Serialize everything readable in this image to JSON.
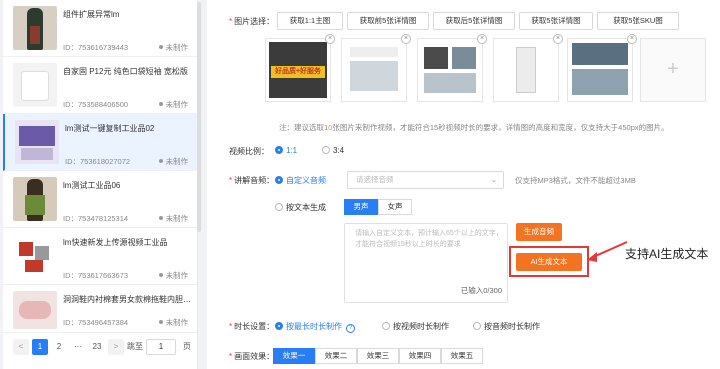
{
  "products": [
    {
      "title": "组件扩展异常lm",
      "id": "ID：753616739443",
      "status": "未制作"
    },
    {
      "title": "自家固 P12元 纯色口袋短袖 宽松版",
      "id": "ID：753588406500",
      "status": "未制作"
    },
    {
      "title": "lm测试一键复制工业品02",
      "id": "ID：753618027072",
      "status": "未制作"
    },
    {
      "title": "lm测试工业品06",
      "id": "ID：753478125314",
      "status": "未制作"
    },
    {
      "title": "lm快速新发上传源视频工业品",
      "id": "ID：753617663673",
      "status": "未制作"
    },
    {
      "title": "洞洞鞋内衬棉套男女款棉拖鞋内胆可…",
      "id": "ID：753496457384",
      "status": "未制作"
    }
  ],
  "pager": {
    "prev": "<",
    "page1": "1",
    "page2": "2",
    "ellipsis": "···",
    "last": "23",
    "next": ">",
    "goto_label": "跳至",
    "goto_value": "1",
    "page_suffix": "页"
  },
  "form": {
    "image_label": "图片选择：",
    "image_buttons": [
      "获取1:1主图",
      "获取前5张详情图",
      "获取后5张详情图",
      "获取5张详情图",
      "获取5张SKU图"
    ],
    "banner_text": "好品质+好服务",
    "add_icon": "plus-icon",
    "note_prefix": "注：建议选取1",
    "note_highlight": "0",
    "note_suffix": "张图片来制作视频，才能符合15秒视频时长的要求，详情图的高度和宽度，仅支持大于450px的图片。",
    "ratio_label": "视频比例：",
    "ratio_1": "1:1",
    "ratio_2": "3:4",
    "audio_label": "讲解音频：",
    "custom_audio": "自定义音频",
    "audio_placeholder": "请选择音频",
    "audio_hint": "仅支持MP3格式，文件不能超过3MB",
    "text_gen": "按文本生成",
    "male_voice": "男声",
    "female_voice": "女声",
    "textarea_placeholder": "请输入自定义文本，预计输入65个以上的文字，才能符合视频15秒以上时长的要求",
    "char_count": "已输入0/300",
    "gen_audio_button": "生成音频",
    "ai_text_button": "AI生成文本",
    "callout": "支持AI生成文本",
    "duration_label": "时长设置：",
    "dur_1": "按最长时长制作",
    "dur_2": "按视频时长制作",
    "dur_3": "按音频时长制作",
    "effect_label": "画面效果：",
    "effects": [
      "效果一",
      "效果二",
      "效果三",
      "效果四",
      "效果五"
    ]
  },
  "colors": {
    "accent": "#2a7ef4",
    "orange": "#f37320",
    "red": "#e53935"
  }
}
